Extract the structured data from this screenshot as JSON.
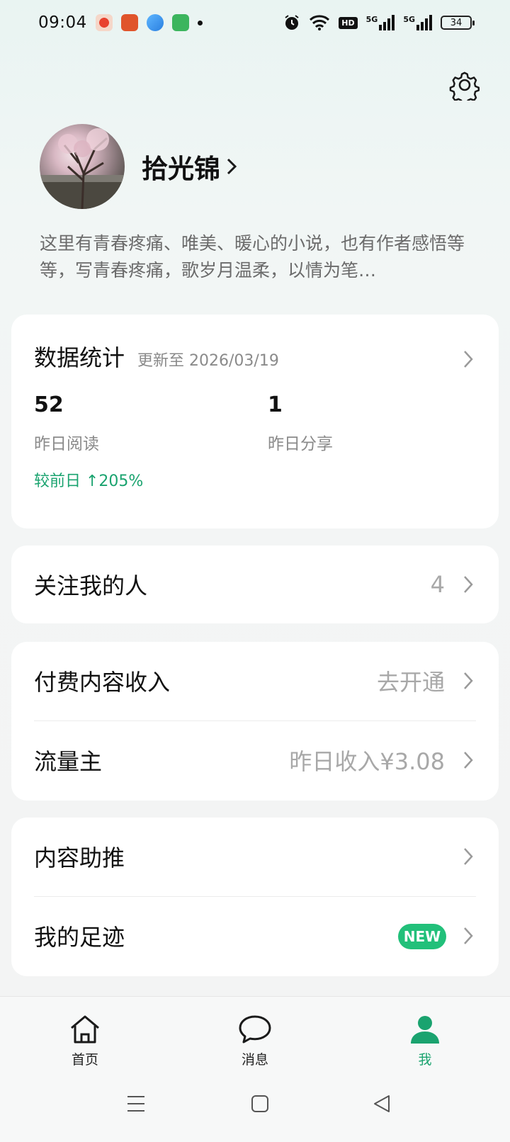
{
  "status_bar": {
    "time": "09:04",
    "hd": "HD",
    "net1": "5G",
    "net2": "5G",
    "battery": "34"
  },
  "profile": {
    "username": "拾光锦",
    "bio": "这里有青春疼痛、唯美、暖心的小说，也有作者感悟等等，写青春疼痛，歌岁月温柔，以情为笔…"
  },
  "stats": {
    "title": "数据统计",
    "updated": "更新至 2026/03/19",
    "reads_value": "52",
    "reads_label": "昨日阅读",
    "reads_delta": "较前日 ↑205%",
    "shares_value": "1",
    "shares_label": "昨日分享"
  },
  "followers": {
    "label": "关注我的人",
    "count": "4"
  },
  "income": {
    "paid_label": "付费内容收入",
    "paid_action": "去开通",
    "traffic_label": "流量主",
    "traffic_value": "昨日收入¥3.08"
  },
  "tools": {
    "promote_label": "内容助推",
    "footprint_label": "我的足迹",
    "footprint_badge": "NEW"
  },
  "nav": {
    "home": "首页",
    "messages": "消息",
    "me": "我"
  },
  "colors": {
    "accent": "#1aa36f",
    "badge": "#22c07a"
  },
  "icons": [
    "settings-gear-icon",
    "chevron-right-icon",
    "home-icon",
    "message-bubble-icon",
    "person-icon"
  ]
}
